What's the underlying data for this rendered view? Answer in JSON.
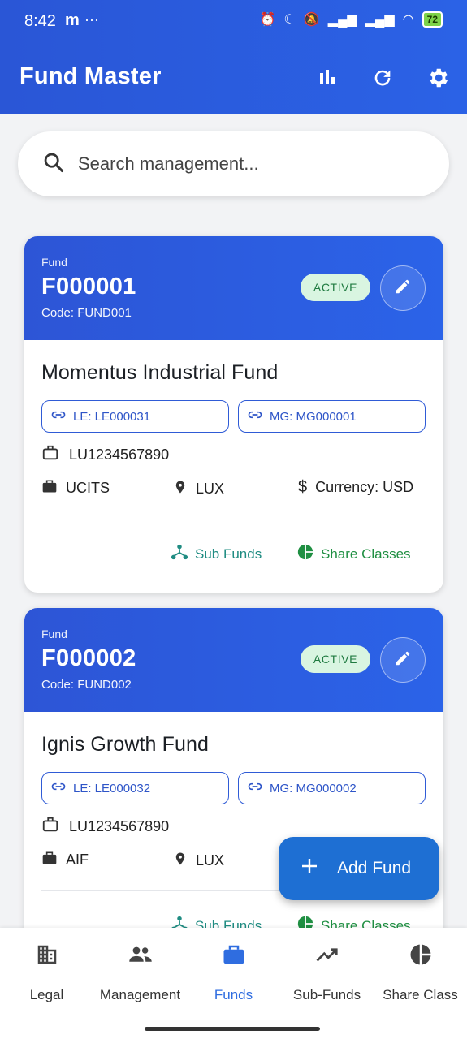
{
  "status_bar": {
    "time": "8:42",
    "carrier_icon": "m",
    "more": "···",
    "battery": "72"
  },
  "app_bar": {
    "title": "Fund Master",
    "actions": [
      "chart-icon",
      "refresh-icon",
      "settings-icon"
    ]
  },
  "search": {
    "placeholder": "Search management..."
  },
  "funds": [
    {
      "label": "Fund",
      "id": "F000001",
      "code": "Code: FUND001",
      "status": "ACTIVE",
      "name": "Momentus Industrial Fund",
      "le": "LE: LE000031",
      "mg": "MG: MG000001",
      "isin": "LU1234567890",
      "type": "UCITS",
      "domicile": "LUX",
      "currency": "Currency: USD",
      "sub_funds": "Sub Funds",
      "share_classes": "Share Classes"
    },
    {
      "label": "Fund",
      "id": "F000002",
      "code": "Code: FUND002",
      "status": "ACTIVE",
      "name": "Ignis Growth Fund",
      "le": "LE: LE000032",
      "mg": "MG: MG000002",
      "isin": "LU1234567890",
      "type": "AIF",
      "domicile": "LUX",
      "sub_funds": "Sub Funds",
      "share_classes": "Share Classes"
    }
  ],
  "fab": {
    "label": "Add Fund"
  },
  "bottom_nav": [
    {
      "label": "Legal",
      "icon": "building-icon"
    },
    {
      "label": "Management",
      "icon": "people-icon"
    },
    {
      "label": "Funds",
      "icon": "briefcase-icon",
      "active": true
    },
    {
      "label": "Sub-Funds",
      "icon": "trend-icon"
    },
    {
      "label": "Share Class",
      "icon": "pie-icon"
    }
  ],
  "colors": {
    "primary": "#2b5bde",
    "active_badge_bg": "#d9f5e1",
    "active_badge_text": "#1f7a40",
    "fab": "#1e6fd3"
  }
}
